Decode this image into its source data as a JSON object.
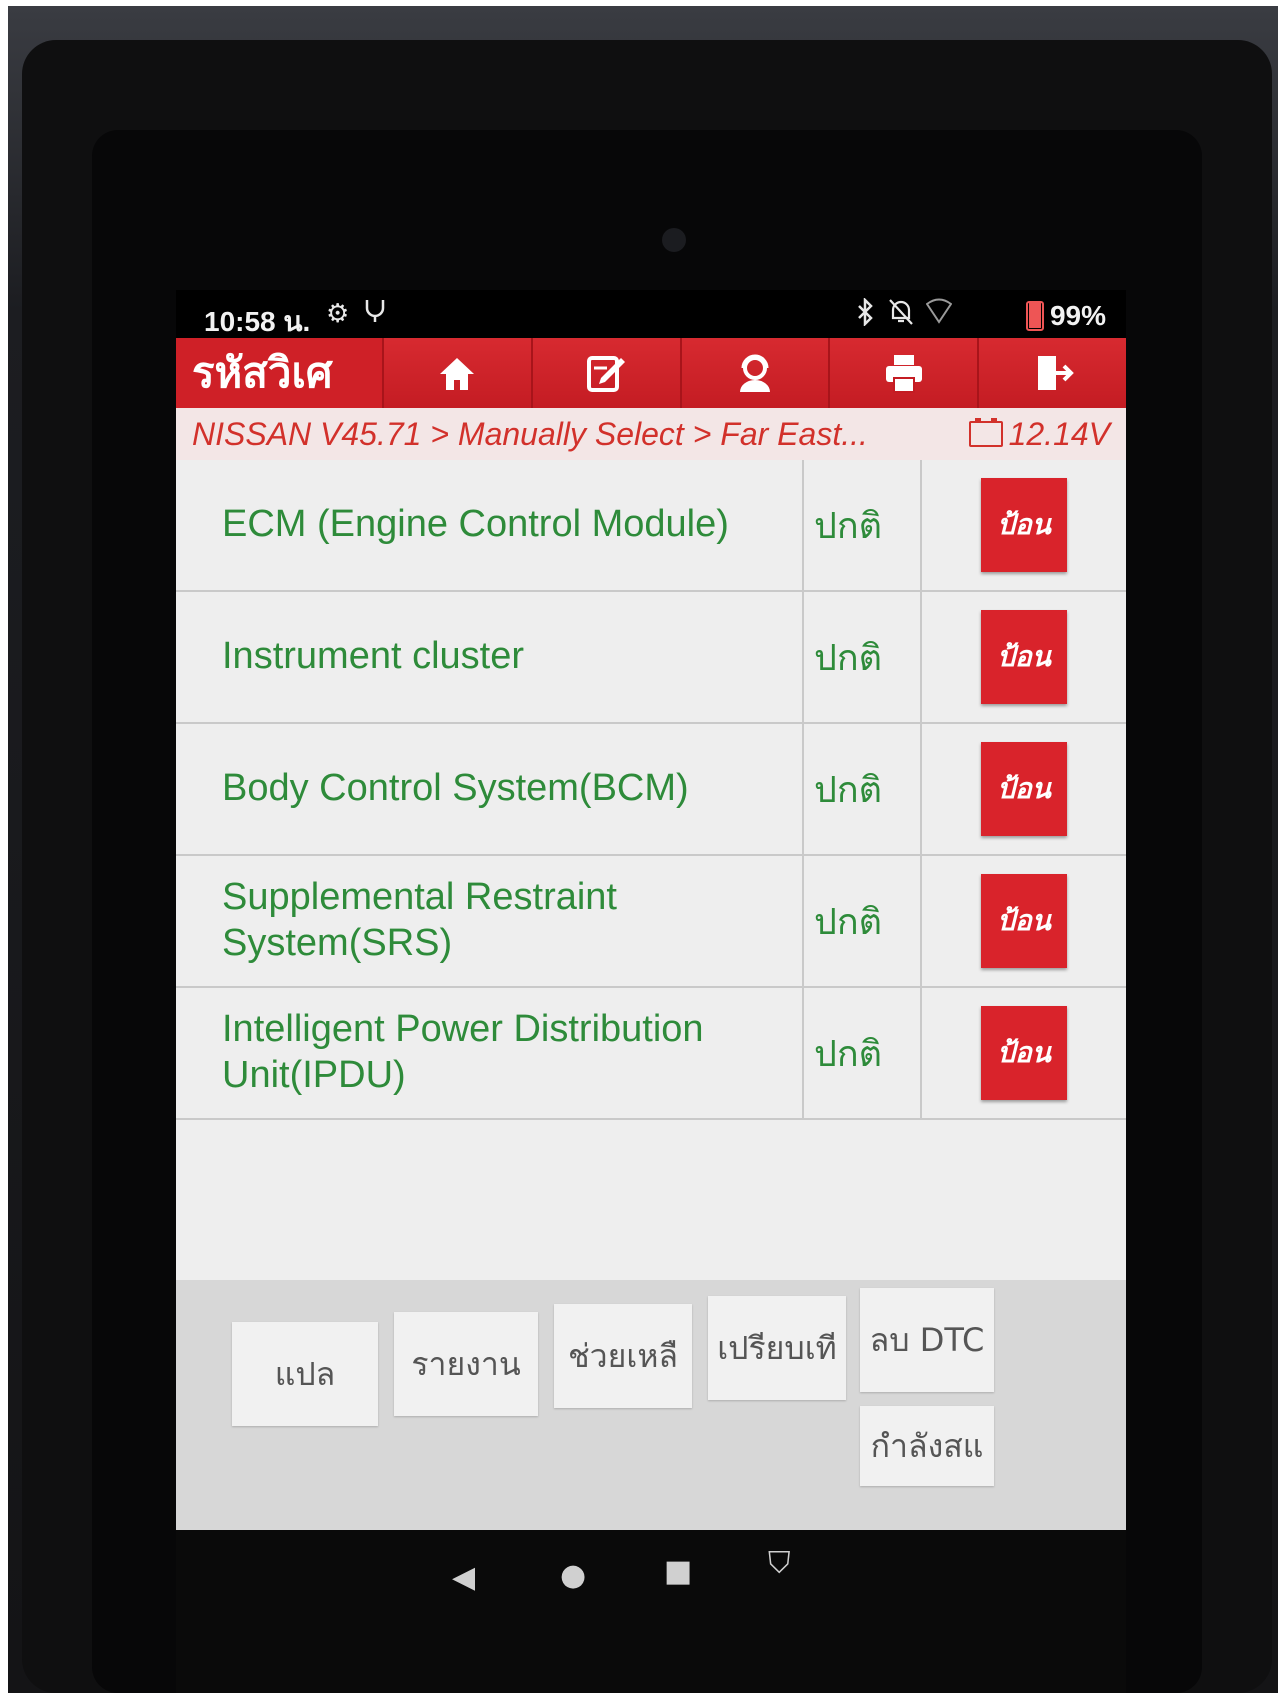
{
  "status_bar": {
    "time": "10:58 น.",
    "left_icons": [
      "gear-icon",
      "stethoscope-icon"
    ],
    "right_icons": [
      "bluetooth-icon",
      "mute-bell-icon",
      "wifi-icon"
    ],
    "battery_percent": "99%",
    "battery_level": 0.99
  },
  "header": {
    "title": "รหัสวิเศ",
    "buttons": [
      "home-icon",
      "edit-icon",
      "support-icon",
      "print-icon",
      "exit-icon"
    ],
    "color": "#cf2027"
  },
  "breadcrumb": {
    "path": "NISSAN V45.71 > Manually Select > Far East...",
    "voltage": "12.14V"
  },
  "systems": [
    {
      "name": "ECM (Engine Control Module)",
      "status": "ปกติ",
      "action": "ป้อน"
    },
    {
      "name": "Instrument cluster",
      "status": "ปกติ",
      "action": "ป้อน"
    },
    {
      "name": "Body Control System(BCM)",
      "status": "ปกติ",
      "action": "ป้อน"
    },
    {
      "name": "Supplemental Restraint System(SRS)",
      "status": "ปกติ",
      "action": "ป้อน"
    },
    {
      "name": "Intelligent Power Distribution Unit(IPDU)",
      "status": "ปกติ",
      "action": "ป้อน"
    }
  ],
  "bottom_buttons": {
    "translate": "แปล",
    "report": "รายงาน",
    "help": "ช่วยเหลื",
    "compare": "เปรียบเที",
    "clear_dtc": "ลบ DTC",
    "processing": "กำลังสแ"
  },
  "colors": {
    "accent_red": "#cf2027",
    "ok_green": "#2e8b3a"
  }
}
